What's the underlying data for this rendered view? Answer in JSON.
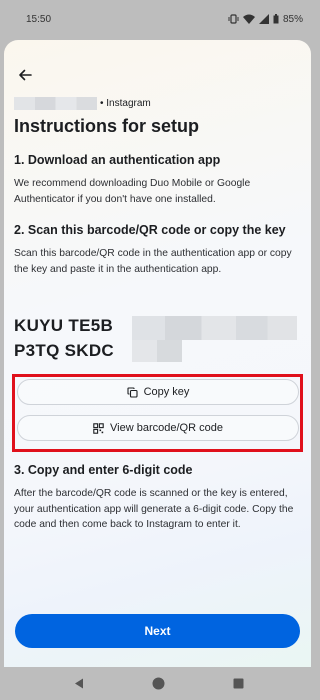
{
  "status_bar": {
    "time": "15:50",
    "battery": "85%",
    "icons": [
      "vibrate-icon",
      "wifi-icon",
      "signal-icon",
      "battery-icon"
    ]
  },
  "header": {
    "account_suffix": "• Instagram",
    "title": "Instructions for setup"
  },
  "steps": [
    {
      "heading": "1. Download an authentication app",
      "body": "We recommend downloading Duo Mobile or Google Authenticator if you don't have one installed."
    },
    {
      "heading": "2. Scan this barcode/QR code or copy the key",
      "body": "Scan this barcode/QR code in the authentication app or copy the key and paste it in the authentication app."
    },
    {
      "heading": "3. Copy and enter 6-digit code",
      "body": "After the barcode/QR code is scanned or the key is entered, your authentication app will generate a 6-digit code. Copy the code and then come back to Instagram to enter it."
    }
  ],
  "key": {
    "line1_visible": "KUYU TE5B",
    "line2_visible": "P3TQ SKDC"
  },
  "actions": {
    "copy_key_label": "Copy key",
    "view_qr_label": "View barcode/QR code",
    "next_label": "Next"
  },
  "colors": {
    "primary": "#0064e0",
    "highlight": "#e0101b"
  }
}
